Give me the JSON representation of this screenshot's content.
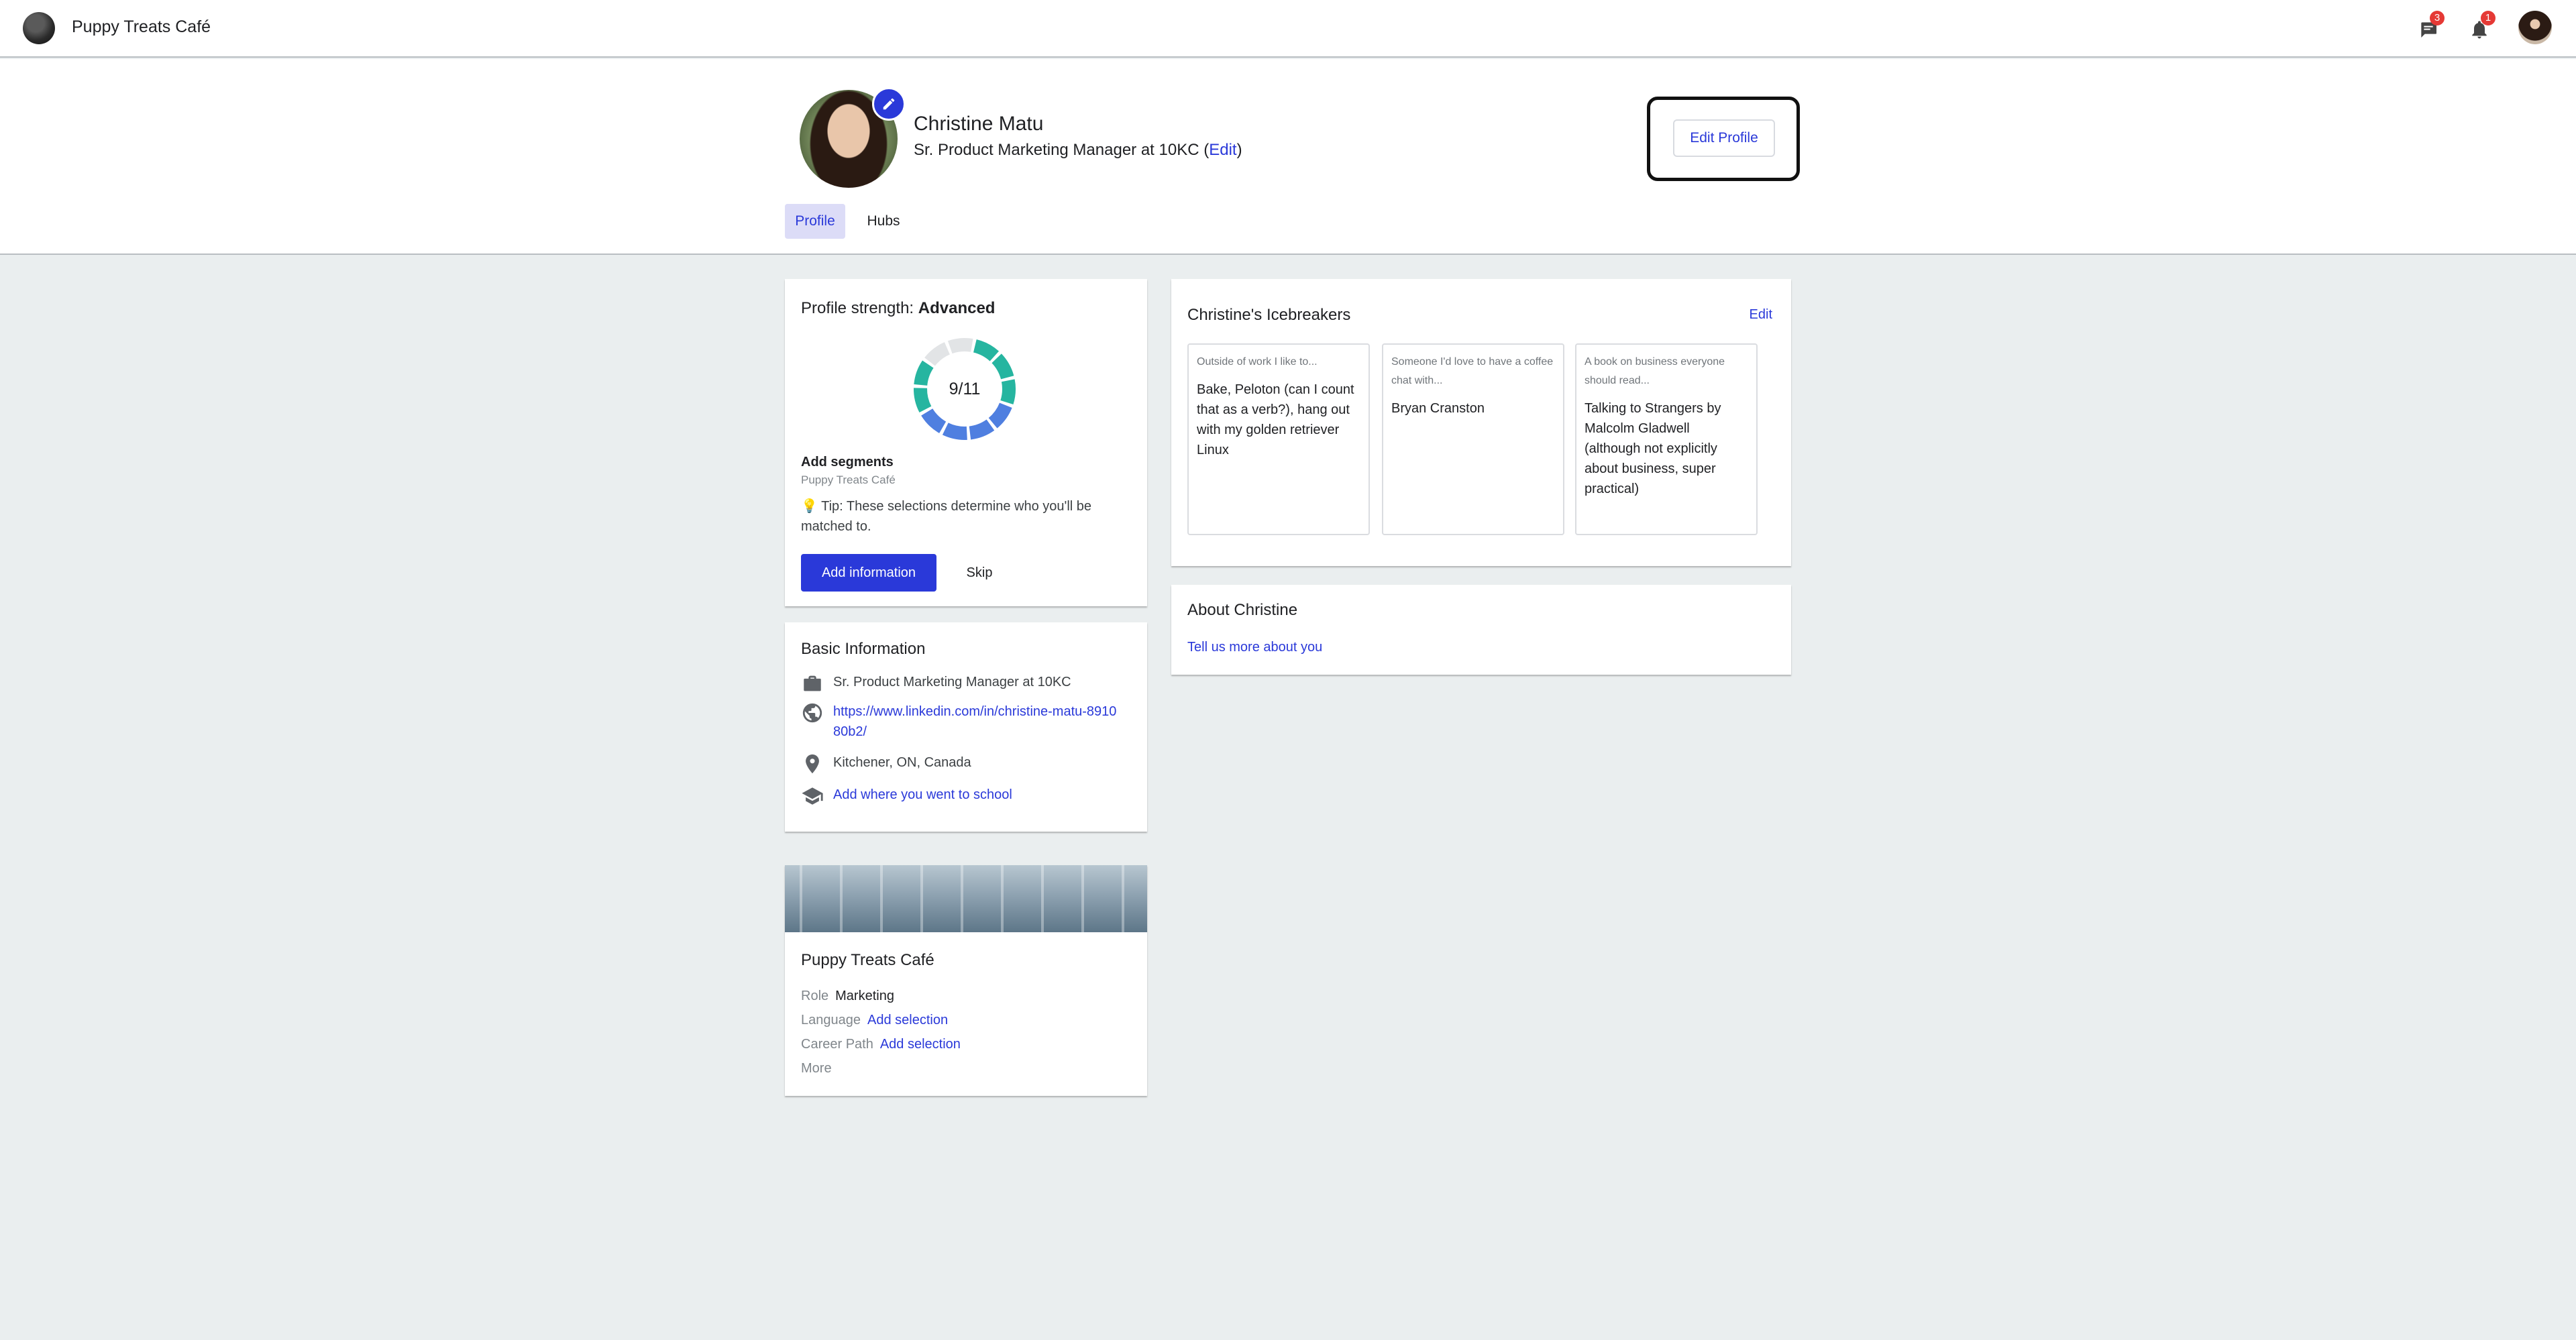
{
  "topbar": {
    "brand_name": "Puppy Treats Café",
    "messages_badge": "3",
    "notifications_badge": "1"
  },
  "profile": {
    "name": "Christine Matu",
    "title": "Sr. Product Marketing Manager at 10KC",
    "title_edit_link": "Edit",
    "edit_profile_label": "Edit Profile",
    "tabs": [
      {
        "label": "Profile",
        "active": true
      },
      {
        "label": "Hubs",
        "active": false
      }
    ]
  },
  "strength": {
    "label": "Profile strength:",
    "level": "Advanced",
    "progress_text": "9/11",
    "completed": 9,
    "total": 11,
    "segments_title": "Add segments",
    "segments_subtitle": "Puppy Treats Café",
    "tip_icon": "lightbulb-icon",
    "tip": "Tip: These selections determine who you'll be matched to.",
    "primary_button": "Add information",
    "skip_button": "Skip"
  },
  "basic_info": {
    "title": "Basic Information",
    "job": "Sr. Product Marketing Manager at 10KC",
    "linkedin": "https://www.linkedin.com/in/christine-matu-891080b2/",
    "location": "Kitchener, ON, Canada",
    "school_prompt": "Add where you went to school"
  },
  "hub": {
    "title": "Puppy Treats Café",
    "role_label": "Role",
    "role_value": "Marketing",
    "language_label": "Language",
    "language_value": "Add selection",
    "career_label": "Career Path",
    "career_value": "Add selection",
    "more_label": "More"
  },
  "icebreakers": {
    "title": "Christine's Icebreakers",
    "edit_label": "Edit",
    "items": [
      {
        "prompt": "Outside of work I like to...",
        "answer": "Bake, Peloton (can I count that as a verb?), hang out with my golden retriever Linux"
      },
      {
        "prompt": "Someone I'd love to have a coffee chat with...",
        "answer": "Bryan Cranston"
      },
      {
        "prompt": "A book on business everyone should read...",
        "answer": "Talking to Strangers by Malcolm Gladwell (although not explicitly about business, super practical)"
      }
    ]
  },
  "about": {
    "title": "About Christine",
    "prompt": "Tell us more about you"
  },
  "colors": {
    "accent": "#2a39d9",
    "donut_teal": "#26b5a0",
    "donut_blue": "#4f7fe0",
    "donut_empty": "#e2e4e6",
    "badge_red": "#e53935"
  }
}
